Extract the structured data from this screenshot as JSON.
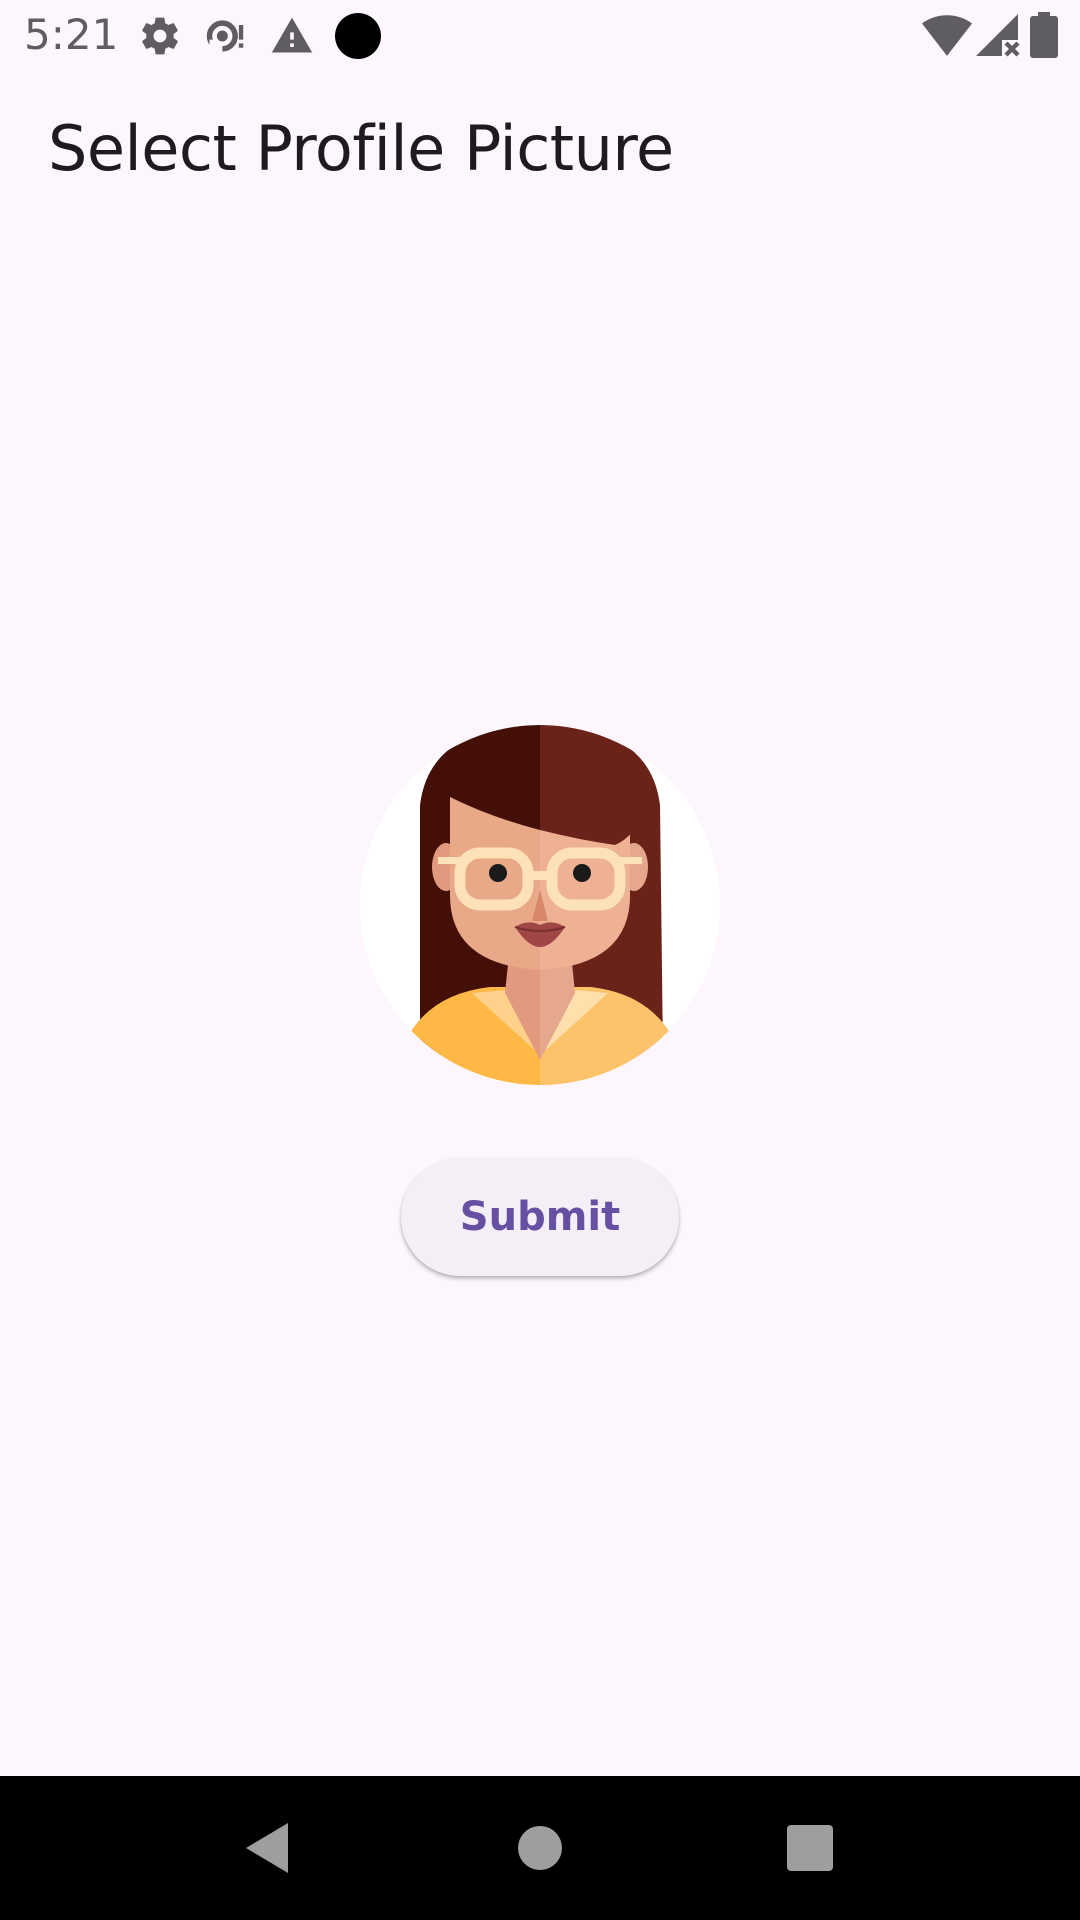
{
  "status_bar": {
    "time": "5:21",
    "left_icons": [
      "settings-icon",
      "sync-alert-icon",
      "warning-icon",
      "record-dot-icon"
    ],
    "right_icons": [
      "wifi-icon",
      "signal-no-service-icon",
      "battery-icon"
    ]
  },
  "header": {
    "title": "Select Profile Picture"
  },
  "main": {
    "avatar_icon": "female-avatar-glasses",
    "submit_label": "Submit"
  },
  "nav_bar": {
    "buttons": [
      "back-icon",
      "home-icon",
      "recents-icon"
    ]
  },
  "colors": {
    "background": "#fdf7fd",
    "accent": "#6750a4",
    "button_bg": "#f4eff6",
    "title_text": "#1d1b20"
  }
}
